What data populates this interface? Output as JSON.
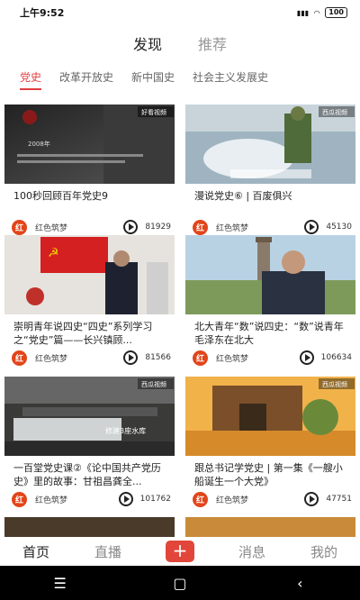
{
  "status": {
    "time": "上午9:52",
    "battery": "100"
  },
  "top_tabs": [
    "发现",
    "推荐"
  ],
  "categories": [
    "党史",
    "改革开放史",
    "新中国史",
    "社会主义发展史"
  ],
  "cards": [
    {
      "title": "100秒回顾百年党史9",
      "author": "红色筑梦",
      "views": "81929",
      "overlay": "2008年",
      "brand": "好看视频"
    },
    {
      "title": "漫说党史⑥ | 百废俱兴",
      "author": "红色筑梦",
      "views": "45130",
      "brand": "西瓜视频"
    },
    {
      "title": "崇明青年说四史“四史”系列学习之“党史”篇——长兴镇顾...",
      "author": "红色筑梦",
      "views": "81566"
    },
    {
      "title": "北大青年“数”说四史：“数”说青年毛泽东在北大",
      "author": "红色筑梦",
      "views": "106634"
    },
    {
      "title": "一百堂党史课②《论中国共产党历史》里的故事：甘祖昌龚全...",
      "author": "红色筑梦",
      "views": "101762",
      "overlay": "修建3座水库",
      "brand": "西瓜视频"
    },
    {
      "title": "跟总书记学党史 | 第一集《一艘小船诞生一个大党》",
      "author": "红色筑梦",
      "views": "47751",
      "brand": "西瓜视频"
    }
  ],
  "bottom_nav": {
    "home": "首页",
    "live": "直播",
    "plus": "+",
    "messages": "消息",
    "mine": "我的"
  },
  "system_nav": {
    "menu": "☰",
    "home": "▢",
    "back": "‹"
  },
  "badge_char": "红"
}
